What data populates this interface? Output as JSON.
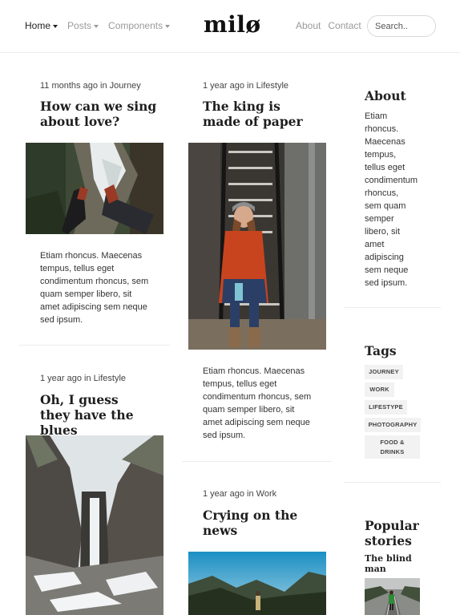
{
  "header": {
    "logo": "milø",
    "nav_left": [
      {
        "label": "Home",
        "active": true
      },
      {
        "label": "Posts",
        "active": false
      },
      {
        "label": "Components",
        "active": false
      }
    ],
    "nav_right": [
      "About",
      "Contact"
    ],
    "search_placeholder": "Search.."
  },
  "posts": [
    {
      "meta": "11 months ago in Journey",
      "title": "How can we sing about love?",
      "excerpt": "Etiam rhoncus. Maecenas tempus, tellus eget condimentum rhoncus, sem quam semper libero, sit amet adipiscing sem neque sed ipsum."
    },
    {
      "meta": "1 year ago in Lifestyle",
      "title": "The king is made of paper",
      "excerpt": "Etiam rhoncus. Maecenas tempus, tellus eget condimentum rhoncus, sem quam semper libero, sit amet adipiscing sem neque sed ipsum."
    },
    {
      "meta": "1 year ago in Lifestyle",
      "title": "Oh, I guess they have the blues"
    },
    {
      "meta": "1 year ago in Work",
      "title": "Crying on the news"
    }
  ],
  "sidebar": {
    "about_heading": "About",
    "about_text": "Etiam rhoncus. Maecenas tempus, tellus eget condimentum rhoncus, sem quam semper libero, sit amet adipiscing sem neque sed ipsum.",
    "tags_heading": "Tags",
    "tags": [
      "Journey",
      "Work",
      "Lifestype",
      "Photography",
      "Food & Drinks"
    ],
    "popular_heading": "Popular stories",
    "popular_item_title": "The blind man"
  },
  "colors": {
    "text": "#222222",
    "muted": "#9a9a9a",
    "tag_bg": "#f2f2f2",
    "divider": "#ececec"
  }
}
